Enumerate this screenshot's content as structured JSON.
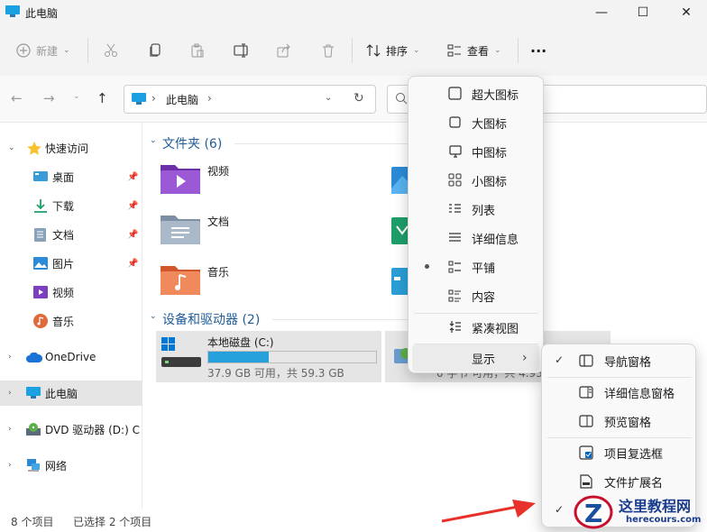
{
  "window": {
    "title": "此电脑",
    "minimize": "—",
    "maximize": "☐",
    "close": "✕"
  },
  "toolbar": {
    "new_label": "新建",
    "sort_label": "排序",
    "view_label": "查看",
    "more_label": "···"
  },
  "address": {
    "path": "此电脑",
    "separator": "›"
  },
  "sidebar": {
    "quick_access": "快速访问",
    "items": [
      {
        "label": "桌面",
        "pinned": true
      },
      {
        "label": "下载",
        "pinned": true
      },
      {
        "label": "文档",
        "pinned": true
      },
      {
        "label": "图片",
        "pinned": true
      },
      {
        "label": "视频",
        "pinned": false
      },
      {
        "label": "音乐",
        "pinned": false
      }
    ],
    "onedrive": "OneDrive",
    "this_pc": "此电脑",
    "dvd": "DVD 驱动器 (D:) CI",
    "network": "网络"
  },
  "main": {
    "folders_header": "文件夹 (6)",
    "folders": [
      "视频",
      "文档",
      "音乐"
    ],
    "drives_header": "设备和驱动器 (2)",
    "drive": {
      "name": "本地磁盘 (C:)",
      "space": "37.9 GB 可用，共 59.3 GB",
      "used_fraction": 0.36
    },
    "drive2_fragment": "0 字节 可用，共 4.93"
  },
  "status": {
    "count": "8 个项目",
    "selected": "已选择 2 个项目"
  },
  "view_menu": {
    "items": [
      {
        "label": "超大图标",
        "icon": "square-icon"
      },
      {
        "label": "大图标",
        "icon": "square-icon"
      },
      {
        "label": "中图标",
        "icon": "monitor-icon"
      },
      {
        "label": "小图标",
        "icon": "grid-icon"
      },
      {
        "label": "列表",
        "icon": "list-icon"
      },
      {
        "label": "详细信息",
        "icon": "details-icon"
      },
      {
        "label": "平铺",
        "icon": "tiles-icon",
        "selected": true
      },
      {
        "label": "内容",
        "icon": "content-icon"
      },
      {
        "label": "紧凑视图",
        "icon": "compact-icon"
      }
    ],
    "show_label": "显示",
    "submenu_arrow": "›"
  },
  "show_submenu": {
    "items": [
      {
        "label": "导航窗格",
        "checked": true
      },
      {
        "label": "详细信息窗格",
        "checked": false
      },
      {
        "label": "预览窗格",
        "checked": false
      },
      {
        "label": "项目复选框",
        "checked": false
      },
      {
        "label": "文件扩展名",
        "checked": false
      },
      {
        "label": "",
        "checked": true
      }
    ]
  },
  "watermark": {
    "title": "这里教程网",
    "url": "herecours.com"
  },
  "colors": {
    "accent": "#0067c0",
    "section_header": "#1f5c99",
    "drive_bar": "#26a0da",
    "arrow": "#e8312a"
  }
}
